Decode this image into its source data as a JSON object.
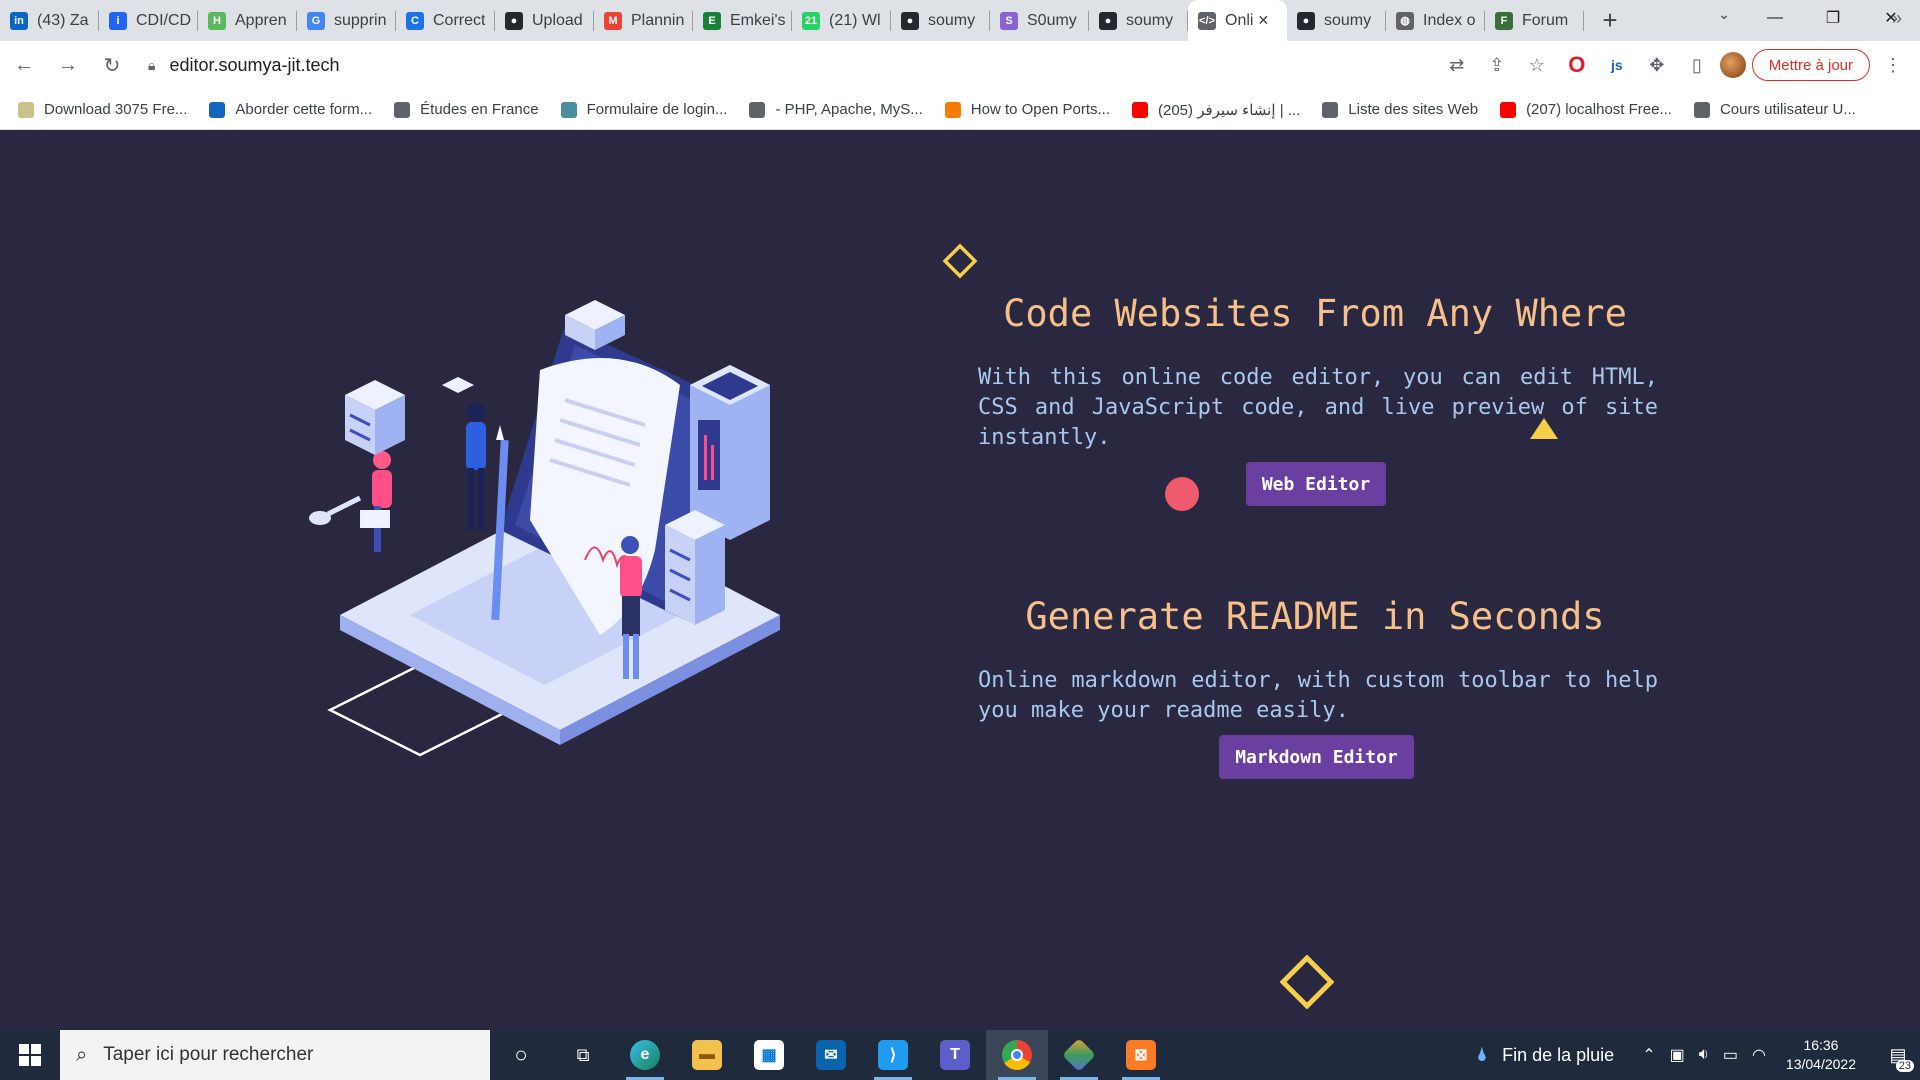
{
  "browser": {
    "tabs": [
      {
        "title": "(43) Za",
        "icon": "linkedin-icon",
        "color": "#0a66c2",
        "glyph": "in"
      },
      {
        "title": "CDI/CD",
        "icon": "indeed-icon",
        "color": "#2164f3",
        "glyph": "i"
      },
      {
        "title": "Appren",
        "icon": "hopwork-icon",
        "color": "#5cb85c",
        "glyph": "H"
      },
      {
        "title": "supprin",
        "icon": "google-icon",
        "color": "#4285f4",
        "glyph": "G"
      },
      {
        "title": "Correct",
        "icon": "corrector-icon",
        "color": "#1a73e8",
        "glyph": "C"
      },
      {
        "title": "Upload",
        "icon": "github-icon",
        "color": "#24292f",
        "glyph": "●"
      },
      {
        "title": "Plannin",
        "icon": "gmail-icon",
        "color": "#ea4335",
        "glyph": "M"
      },
      {
        "title": "Emkei's",
        "icon": "emkei-icon",
        "color": "#188038",
        "glyph": "E"
      },
      {
        "title": "(21) Wl",
        "icon": "whatsapp-icon",
        "color": "#25d366",
        "glyph": "21"
      },
      {
        "title": "soumy",
        "icon": "github-icon",
        "color": "#24292f",
        "glyph": "●"
      },
      {
        "title": "S0umy",
        "icon": "netlify-icon",
        "color": "#8a63d2",
        "glyph": "S"
      },
      {
        "title": "soumy",
        "icon": "github-icon",
        "color": "#24292f",
        "glyph": "●"
      },
      {
        "title": "Onli",
        "icon": "code-page-icon",
        "color": "#5f6368",
        "glyph": "</>",
        "active": true
      },
      {
        "title": "soumy",
        "icon": "github-icon",
        "color": "#24292f",
        "glyph": "●"
      },
      {
        "title": "Index o",
        "icon": "globe-icon",
        "color": "#5f6368",
        "glyph": "◍"
      },
      {
        "title": "Forum",
        "icon": "forum-icon",
        "color": "#3c6e3c",
        "glyph": "F"
      }
    ],
    "url": "editor.soumya-jit.tech",
    "update_label": "Mettre à jour",
    "bookmarks": [
      {
        "label": "Download 3075 Fre...",
        "icon": "bookmark-image-icon",
        "color": "#c9c28a"
      },
      {
        "label": "Aborder cette form...",
        "icon": "bookmark-video-icon",
        "color": "#1565c0"
      },
      {
        "label": "Études en France",
        "icon": "globe-icon",
        "color": "#5f6368"
      },
      {
        "label": "Formulaire de login...",
        "icon": "bookmark-site-icon",
        "color": "#4a8f9f"
      },
      {
        "label": "- PHP, Apache, MyS...",
        "icon": "globe-icon",
        "color": "#5f6368"
      },
      {
        "label": "How to Open Ports...",
        "icon": "bookmark-pf-icon",
        "color": "#f57c00"
      },
      {
        "label": "(205) إنشاء سيرفر | ...",
        "icon": "youtube-icon",
        "color": "#ff0000"
      },
      {
        "label": "Liste des sites Web",
        "icon": "globe-icon",
        "color": "#5f6368"
      },
      {
        "label": "(207) localhost Free...",
        "icon": "youtube-icon",
        "color": "#ff0000"
      },
      {
        "label": "Cours utilisateur U...",
        "icon": "globe-icon",
        "color": "#5f6368"
      }
    ]
  },
  "hero": {
    "section1": {
      "title": "Code Websites From Any Where",
      "text": "With this online code editor, you can edit HTML, CSS and JavaScript code, and live preview of site instantly.",
      "button": "Web Editor"
    },
    "section2": {
      "title": "Generate README in Seconds",
      "text": "Online markdown editor, with custom toolbar to help you make your readme easily.",
      "button": "Markdown Editor"
    },
    "colors": {
      "background": "#2a2740",
      "heading": "#f6c08a",
      "text": "#a9c8ee",
      "button": "#6a3fa0",
      "accent_yellow": "#f5cf4a",
      "accent_pink": "#f05a6e"
    }
  },
  "taskbar": {
    "search_placeholder": "Taper ici pour rechercher",
    "weather": "Fin de la pluie",
    "time": "16:36",
    "date": "13/04/2022",
    "notifications": "23",
    "apps": [
      {
        "name": "cortana-icon"
      },
      {
        "name": "task-view-icon"
      },
      {
        "name": "edge-icon"
      },
      {
        "name": "file-explorer-icon"
      },
      {
        "name": "store-icon"
      },
      {
        "name": "mail-icon"
      },
      {
        "name": "vscode-icon"
      },
      {
        "name": "teams-icon"
      },
      {
        "name": "chrome-icon"
      },
      {
        "name": "git-icon"
      },
      {
        "name": "xampp-icon"
      }
    ]
  }
}
